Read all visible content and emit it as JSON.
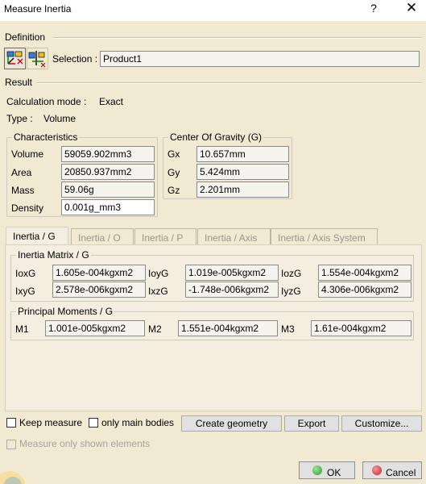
{
  "window": {
    "title": "Measure Inertia",
    "help_label": "?",
    "close_label": "✕"
  },
  "definition": {
    "section_label": "Definition",
    "selection_label": "Selection :",
    "selection_value": "Product1"
  },
  "result": {
    "section_label": "Result",
    "calc_mode_label": "Calculation mode :",
    "calc_mode_value": "Exact",
    "type_label": "Type :",
    "type_value": "Volume"
  },
  "characteristics": {
    "label": "Characteristics",
    "rows": [
      {
        "label": "Volume",
        "value": "59059.902mm3"
      },
      {
        "label": "Area",
        "value": "20850.937mm2"
      },
      {
        "label": "Mass",
        "value": "59.06g"
      },
      {
        "label": "Density",
        "value": "0.001g_mm3"
      }
    ]
  },
  "center_of_gravity": {
    "label": "Center Of Gravity (G)",
    "rows": [
      {
        "label": "Gx",
        "value": "10.657mm"
      },
      {
        "label": "Gy",
        "value": "5.424mm"
      },
      {
        "label": "Gz",
        "value": "2.201mm"
      }
    ]
  },
  "tabs": [
    {
      "label": "Inertia / G",
      "active": true
    },
    {
      "label": "Inertia / O",
      "active": false
    },
    {
      "label": "Inertia / P",
      "active": false
    },
    {
      "label": "Inertia / Axis",
      "active": false
    },
    {
      "label": "Inertia / Axis System",
      "active": false
    }
  ],
  "inertia_matrix": {
    "label": "Inertia Matrix / G",
    "cells": [
      {
        "label": "IoxG",
        "value": "1.605e-004kgxm2"
      },
      {
        "label": "IoyG",
        "value": "1.019e-005kgxm2"
      },
      {
        "label": "IozG",
        "value": "1.554e-004kgxm2"
      },
      {
        "label": "IxyG",
        "value": "2.578e-006kgxm2"
      },
      {
        "label": "IxzG",
        "value": "-1.748e-006kgxm2"
      },
      {
        "label": "IyzG",
        "value": "4.306e-006kgxm2"
      }
    ]
  },
  "principal_moments": {
    "label": "Principal Moments / G",
    "cells": [
      {
        "label": "M1",
        "value": "1.001e-005kgxm2"
      },
      {
        "label": "M2",
        "value": "1.551e-004kgxm2"
      },
      {
        "label": "M3",
        "value": "1.61e-004kgxm2"
      }
    ]
  },
  "options": {
    "keep_measure": "Keep measure",
    "only_main_bodies": "only main bodies",
    "create_geometry": "Create geometry",
    "export": "Export",
    "customize": "Customize...",
    "measure_only_shown": "Measure only shown elements"
  },
  "footer": {
    "ok": "OK",
    "cancel": "Cancel",
    "ok_color": "#2e9a2e",
    "cancel_color": "#c8202a"
  }
}
